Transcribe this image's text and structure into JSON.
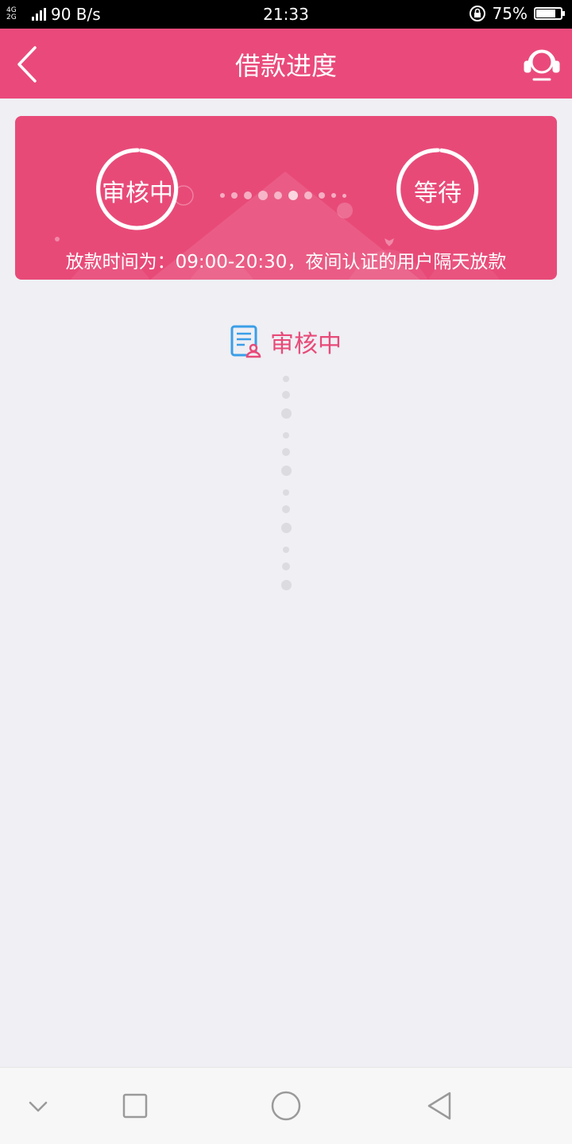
{
  "status_bar": {
    "network_types": "4G 2G",
    "speed": "90 B/s",
    "time": "21:33",
    "battery": "75%",
    "battery_level": 0.75
  },
  "header": {
    "title": "借款进度",
    "back_icon": "chevron-left-icon",
    "support_icon": "headset-icon"
  },
  "progress_card": {
    "step1_label": "审核中",
    "step2_label": "等待",
    "note": "放款时间为：09:00-20:30，夜间认证的用户隔天放款"
  },
  "status": {
    "icon": "document-user-icon",
    "text": "审核中"
  },
  "nav": {
    "items": [
      "chevron-down-icon",
      "square-icon",
      "circle-icon",
      "triangle-back-icon"
    ]
  },
  "colors": {
    "accent": "#ea4a7b",
    "status_bar": "#000000",
    "background": "#efeff4"
  }
}
